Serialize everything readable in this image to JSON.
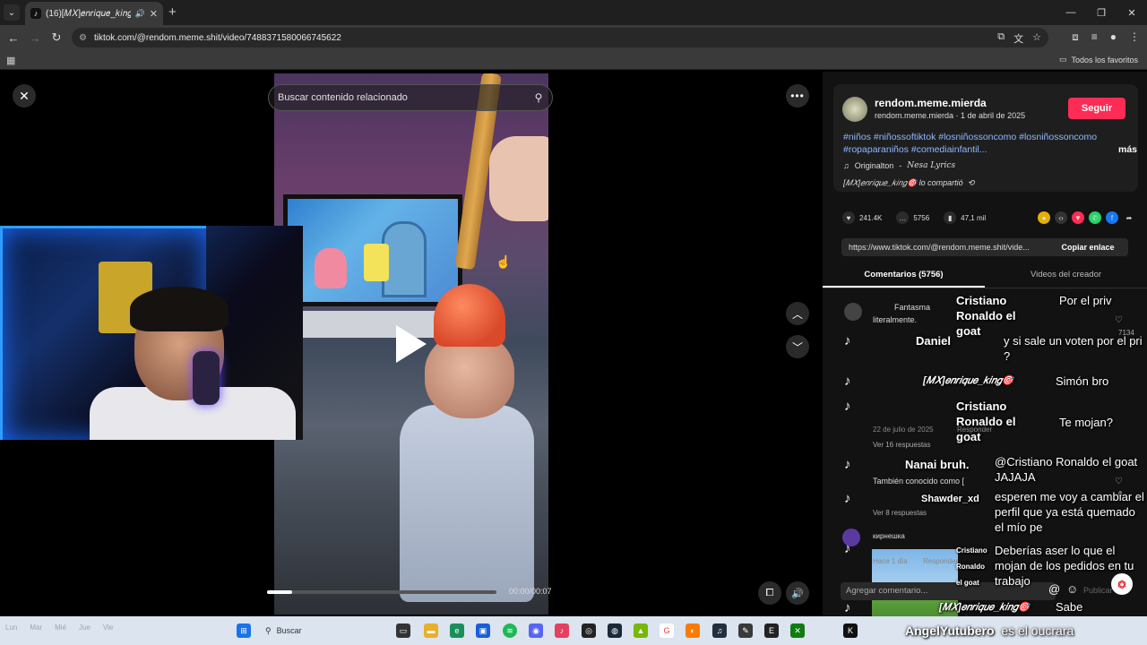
{
  "browser": {
    "tab_title": "(16)[𝑀𝑋]𝑒𝑛𝑟𝑖𝑞𝑢𝑒_𝑘𝑖𝑛𝑔",
    "url": "tiktok.com/@rendom.meme.shit/video/7488371580066745622",
    "bookmarks_label": "Todos los favoritos"
  },
  "viewer": {
    "search_placeholder": "Buscar contenido relacionado",
    "time": "00:00/00:07",
    "progress": 0.11
  },
  "author": {
    "name": "rendom.meme.mierda",
    "sub": "rendom.meme.mierda · 1 de abril de 2025",
    "follow_label": "Seguir",
    "tags": "#niños #niñossoftiktok #losniñossoncomo #losniñossoncomo #ropaparaniños #comediainfantil...",
    "more_label": "más",
    "music": "Originalton",
    "music_artist": "Nesa Lyrics",
    "shared": "[𝑀𝑋]𝑒𝑛𝑟𝑖𝑞𝑢𝑒_𝑘𝑖𝑛𝑔🎯 lo compartió"
  },
  "actions": {
    "likes": "241.4K",
    "comments": "5756",
    "saves": "47,1 mil"
  },
  "share": {
    "url": "https://www.tiktok.com/@rendom.meme.shit/vide...",
    "copy_label": "Copiar enlace"
  },
  "tabs": {
    "comments": "Comentarios (5756)",
    "creator_videos": "Videos del creador"
  },
  "comments": {
    "c1_user": "Fantasma",
    "c1_text": "literalmente.",
    "c2_date": "22 de julio de 2025",
    "c2_reply": "Responder",
    "c2_more": "Ver 16 respuestas",
    "c3_user": "Nanai bruh.",
    "c3_text": "También conocido como [",
    "c4_user": "Shawder_xd",
    "c4_more": "Ver 8 respuestas",
    "c5_user": "кирнешка",
    "c5_date": "Hace 1 día",
    "c5_reply": "Responder",
    "heart_count": "7134",
    "zero": "0"
  },
  "overlay_chat": [
    {
      "user": "Cristiano Ronaldo el goat",
      "msg": "Por el priv"
    },
    {
      "user": "Daniel",
      "msg": "y si sale un voten por el pri ?"
    },
    {
      "user": "[𝑀𝑋]𝑒𝑛𝑟𝑖𝑞𝑢𝑒_𝑘𝑖𝑛𝑔🎯",
      "msg": "Simón bro"
    },
    {
      "user": "Cristiano Ronaldo el goat",
      "msg": "Te mojan?"
    },
    {
      "user": "Nanai bruh.",
      "msg": "@Cristiano Ronaldo el goat JAJAJA"
    },
    {
      "user": "Shawder_xd",
      "msg": "esperen me voy a cambiar el perfil que ya está quemado el mío pe"
    },
    {
      "user": "Cristiano Ronaldo el goat",
      "msg": "Deberías aser lo que el mojan de los pedidos en tu trabajo"
    },
    {
      "user": "[𝑀𝑋]𝑒𝑛𝑟𝑖𝑞𝑢𝑒_𝑘𝑖𝑛𝑔🎯",
      "msg": "Sabe"
    },
    {
      "user": "AngelYutubero",
      "msg": "es el oucrara"
    }
  ],
  "add_comment": {
    "placeholder": "Agregar comentario...",
    "publish": "Publicar"
  },
  "taskbar": {
    "search_label": "Buscar",
    "left_items": [
      "Lun",
      "Mar",
      "Mié",
      "Jue",
      "Vie"
    ]
  },
  "colors": {
    "accent_red": "#fe2c55",
    "hashtag_blue": "#8fb8ff",
    "panel_bg": "#121212"
  },
  "icons": [
    "close-icon",
    "more-icon",
    "search-icon",
    "play-icon",
    "chevron-up-icon",
    "chevron-down-icon",
    "volume-icon",
    "heart-icon",
    "comment-icon",
    "bookmark-icon",
    "share-icon"
  ]
}
